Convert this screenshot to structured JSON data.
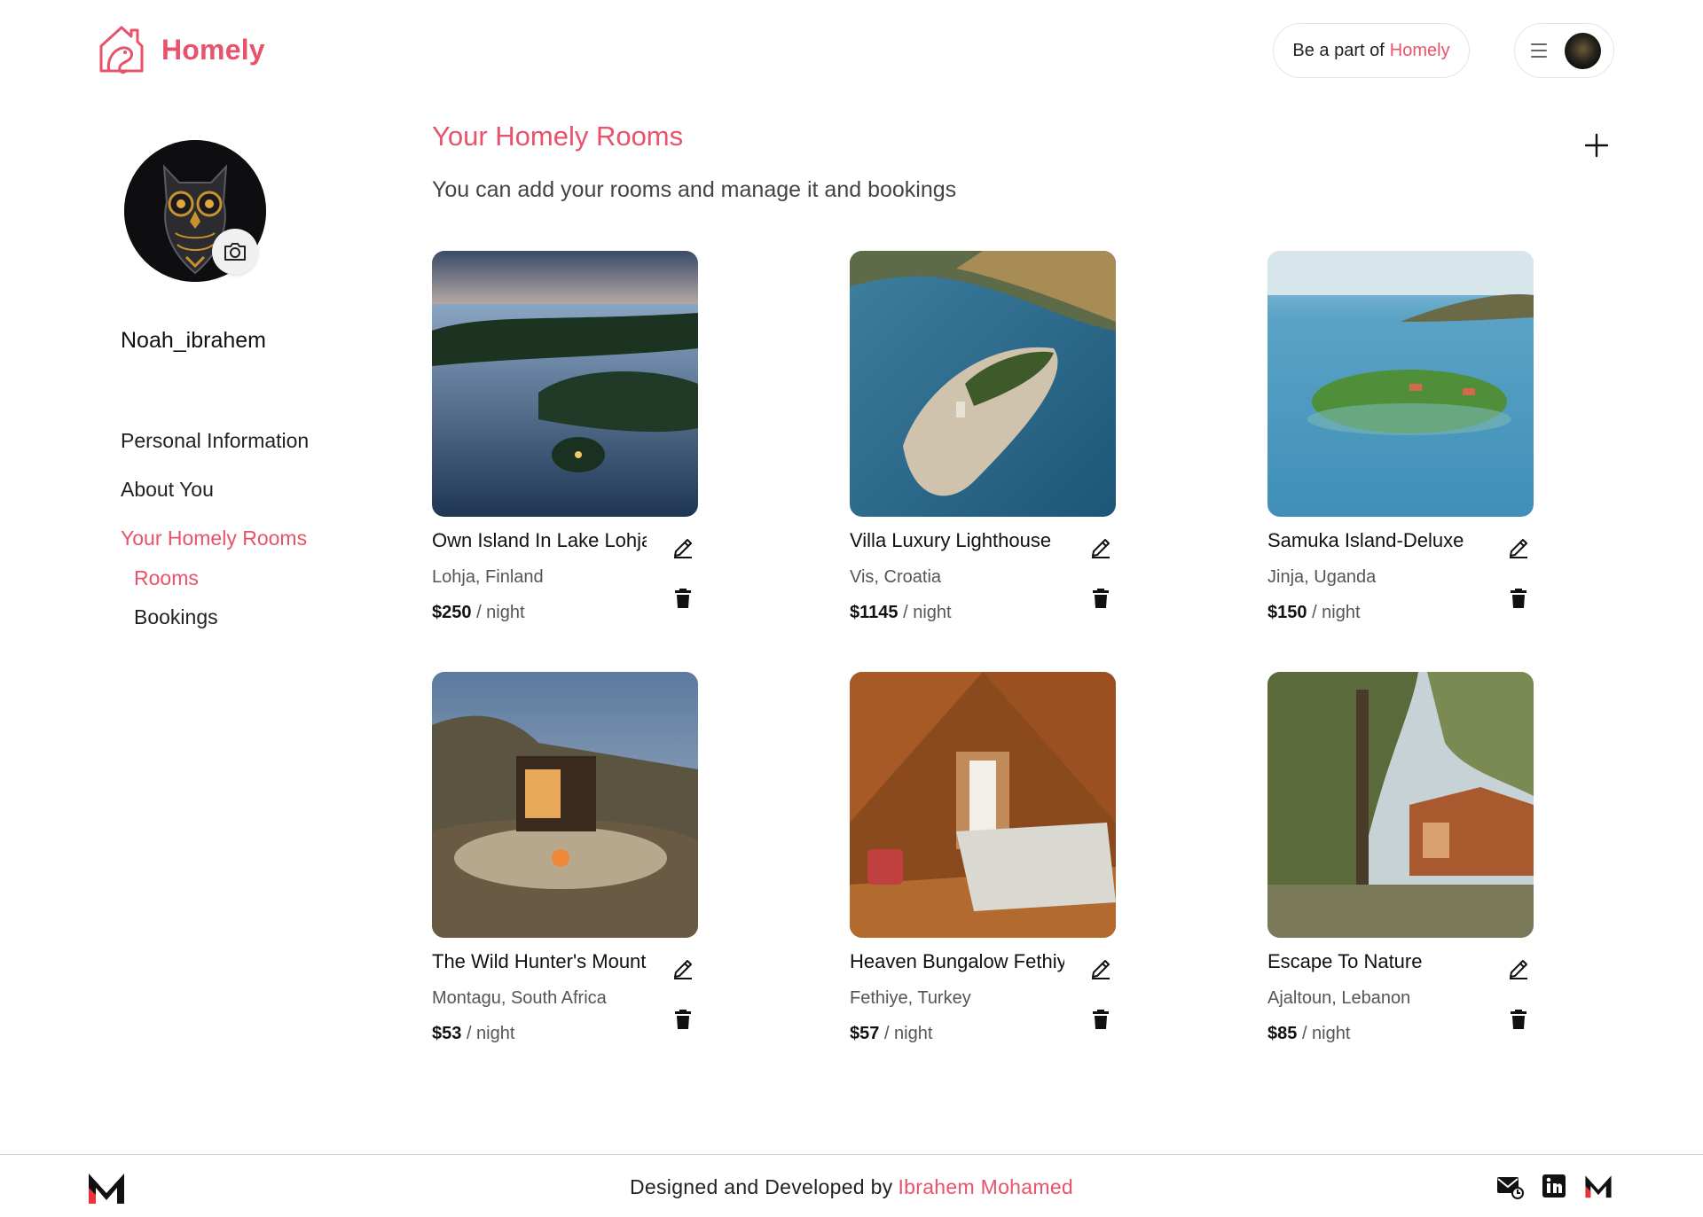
{
  "brand": {
    "name": "Homely",
    "accent_color": "#e8526a"
  },
  "header": {
    "host_prefix": "Be a part of",
    "host_accent": "Homely",
    "menu_icon": "hamburger-icon",
    "avatar": "owl-avatar"
  },
  "profile": {
    "username": "Noah_ibrahem",
    "camera_icon": "camera-icon"
  },
  "sidebar": {
    "items": [
      {
        "label": "Personal Information",
        "active": false
      },
      {
        "label": "About You",
        "active": false
      },
      {
        "label": "Your Homely Rooms",
        "active": true
      },
      {
        "label": "Rooms",
        "active": true,
        "sub": true
      },
      {
        "label": "Bookings",
        "active": false,
        "sub": true
      }
    ]
  },
  "main": {
    "title": "Your Homely Rooms",
    "subtitle": "You can add your rooms and manage it and bookings",
    "add_icon": "plus-icon",
    "rooms": [
      {
        "title": "Own Island In Lake Lohja",
        "location": "Lohja, Finland",
        "price": "$250",
        "unit": "/ night",
        "image": "lake-island-aerial"
      },
      {
        "title": "Villa Luxury Lighthouse",
        "location": "Vis, Croatia",
        "price": "$1145",
        "unit": "/ night",
        "image": "lighthouse-island-aerial"
      },
      {
        "title": "Samuka Island-Deluxe",
        "location": "Jinja, Uganda",
        "price": "$150",
        "unit": "/ night",
        "image": "green-island-aerial"
      },
      {
        "title": "The Wild Hunter's Mountain Cabin",
        "location": "Montagu, South Africa",
        "price": "$53",
        "unit": "/ night",
        "image": "mountain-cabin-firepit"
      },
      {
        "title": "Heaven Bungalow Fethiye",
        "location": "Fethiye, Turkey",
        "price": "$57",
        "unit": "/ night",
        "image": "wooden-bungalow-interior"
      },
      {
        "title": "Escape To Nature",
        "location": "Ajaltoun, Lebanon",
        "price": "$85",
        "unit": "/ night",
        "image": "forest-cabin"
      }
    ]
  },
  "footer": {
    "credit_prefix": "Designed and Developed by",
    "credit_name": "Ibrahem Mohamed",
    "icons": [
      "mail-icon",
      "linkedin-icon",
      "m-logo-icon"
    ]
  }
}
